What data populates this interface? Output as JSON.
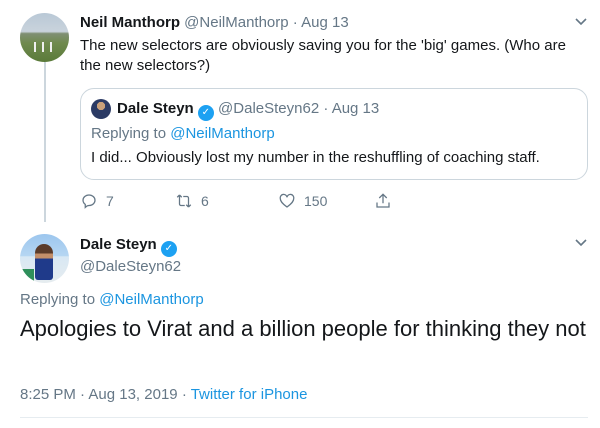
{
  "tweet1": {
    "name": "Neil Manthorp",
    "handle": "@NeilManthorp",
    "separator": "·",
    "date": "Aug 13",
    "text": "The new selectors are obviously saving you for the 'big' games. (Who are the new selectors?)",
    "replies": "7",
    "retweets": "6",
    "likes": "150"
  },
  "quote": {
    "name": "Dale Steyn",
    "handle": "@DaleSteyn62",
    "separator": "·",
    "date": "Aug 13",
    "replying_prefix": "Replying to",
    "replying_to": "@NeilManthorp",
    "text": "I did... Obviously lost my number in the reshuffling of coaching staff."
  },
  "main": {
    "name": "Dale Steyn",
    "handle": "@DaleSteyn62",
    "replying_prefix": "Replying to",
    "replying_to": "@NeilManthorp",
    "text": "Apologies to Virat and a billion people for thinking they not",
    "time": "8:25 PM",
    "separator": "·",
    "date": "Aug 13, 2019",
    "source": "Twitter for iPhone"
  },
  "colors": {
    "accent": "#1da1f2",
    "link": "#1b95e0",
    "muted": "#657786"
  },
  "icons": [
    "chevron-down-icon",
    "verified-badge-icon",
    "reply-icon",
    "retweet-icon",
    "like-icon",
    "share-icon"
  ]
}
